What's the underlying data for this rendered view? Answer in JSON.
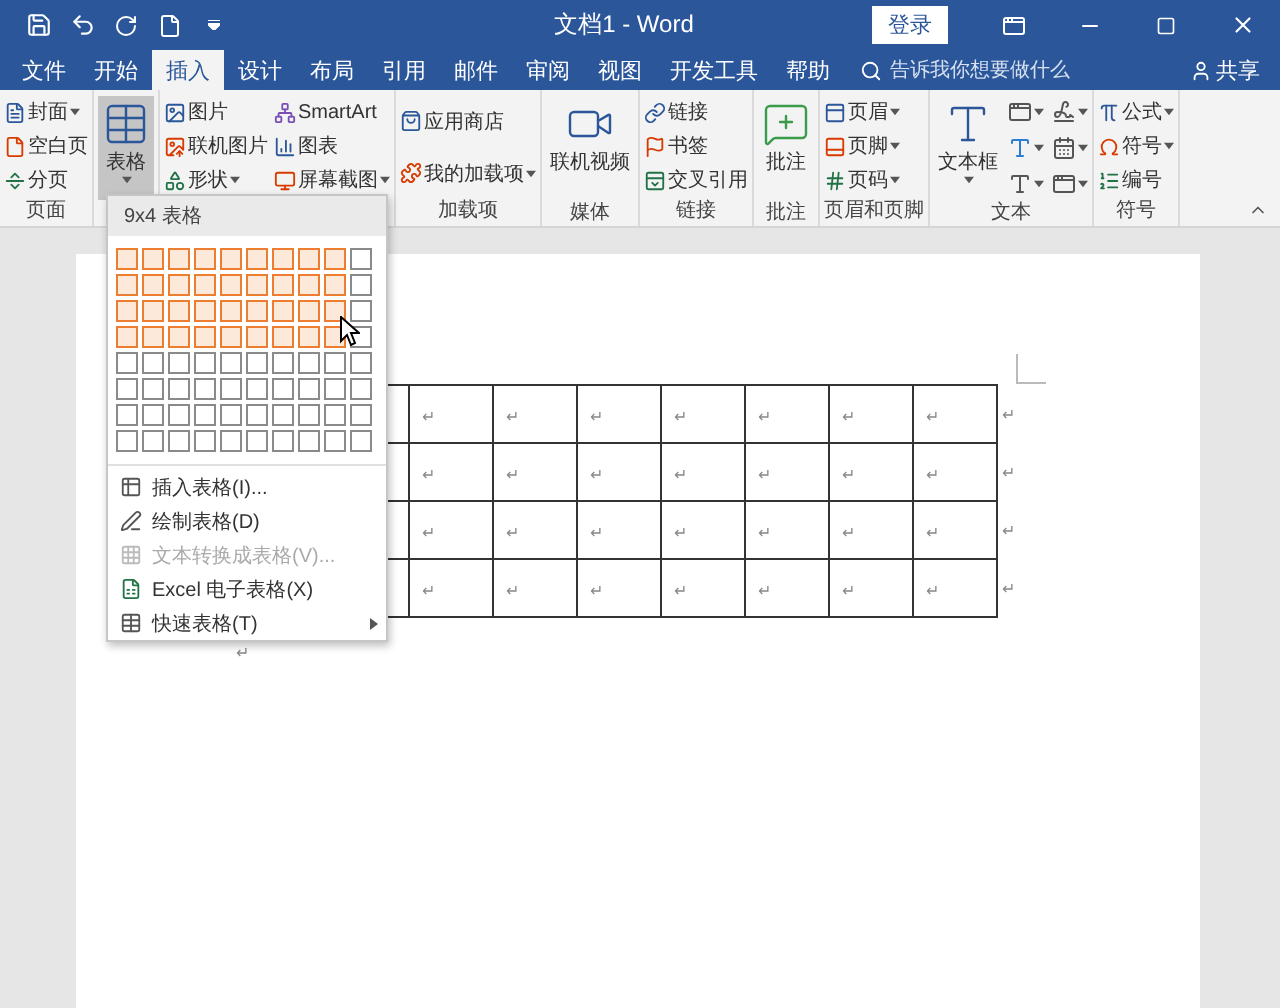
{
  "title_bar": {
    "title": "文档1 - Word",
    "sign_in": "登录"
  },
  "tabs": [
    {
      "label": "文件",
      "selected": false
    },
    {
      "label": "开始",
      "selected": false
    },
    {
      "label": "插入",
      "selected": true
    },
    {
      "label": "设计",
      "selected": false
    },
    {
      "label": "布局",
      "selected": false
    },
    {
      "label": "引用",
      "selected": false
    },
    {
      "label": "邮件",
      "selected": false
    },
    {
      "label": "审阅",
      "selected": false
    },
    {
      "label": "视图",
      "selected": false
    },
    {
      "label": "开发工具",
      "selected": false
    },
    {
      "label": "帮助",
      "selected": false
    }
  ],
  "search": {
    "placeholder": "告诉我你想要做什么"
  },
  "share": "共享",
  "ribbon": {
    "groups": [
      {
        "label": "页面",
        "items": [
          {
            "label": "封面",
            "kind": "small",
            "dropdown": true
          },
          {
            "label": "空白页",
            "kind": "small",
            "dropdown": false
          },
          {
            "label": "分页",
            "kind": "small",
            "dropdown": false
          }
        ]
      },
      {
        "items": [
          {
            "label": "表格",
            "kind": "large",
            "dropdown": true,
            "pressed": true
          }
        ]
      },
      {
        "items": [
          {
            "label": "图片",
            "kind": "small",
            "dropdown": false
          },
          {
            "label": "联机图片",
            "kind": "small",
            "dropdown": false
          },
          {
            "label": "形状",
            "kind": "small",
            "dropdown": true
          },
          {
            "label": "SmartArt",
            "kind": "small",
            "dropdown": false
          },
          {
            "label": "图表",
            "kind": "small",
            "dropdown": false
          },
          {
            "label": "屏幕截图",
            "kind": "small",
            "dropdown": true
          }
        ]
      },
      {
        "label": "加载项",
        "items": [
          {
            "label": "应用商店",
            "kind": "small",
            "dropdown": false
          },
          {
            "label": "我的加载项",
            "kind": "small",
            "dropdown": true
          }
        ]
      },
      {
        "label": "媒体",
        "items": [
          {
            "label": "联机视频",
            "kind": "large",
            "dropdown": false,
            "pressed": false
          }
        ]
      },
      {
        "label": "链接",
        "items": [
          {
            "label": "链接",
            "kind": "small",
            "dropdown": false
          },
          {
            "label": "书签",
            "kind": "small",
            "dropdown": false
          },
          {
            "label": "交叉引用",
            "kind": "small",
            "dropdown": false
          }
        ]
      },
      {
        "label": "批注",
        "items": [
          {
            "label": "批注",
            "kind": "large",
            "dropdown": false,
            "pressed": false
          }
        ]
      },
      {
        "label": "页眉和页脚",
        "items": [
          {
            "label": "页眉",
            "kind": "small",
            "dropdown": true
          },
          {
            "label": "页脚",
            "kind": "small",
            "dropdown": true
          },
          {
            "label": "页码",
            "kind": "small",
            "dropdown": true
          }
        ]
      },
      {
        "label": "文本",
        "items": [
          {
            "label": "文本框",
            "kind": "large",
            "dropdown": true,
            "pressed": false
          },
          {
            "kind": "icons"
          }
        ]
      },
      {
        "label": "符号",
        "items": [
          {
            "label": "公式",
            "kind": "small",
            "dropdown": true
          },
          {
            "label": "符号",
            "kind": "small",
            "dropdown": true
          },
          {
            "label": "编号",
            "kind": "small",
            "dropdown": false
          }
        ]
      }
    ]
  },
  "table_menu": {
    "header": "9x4 表格",
    "grid": [
      {
        "cells": [
          true,
          true,
          true,
          true,
          true,
          true,
          true,
          true,
          true,
          false
        ]
      },
      {
        "cells": [
          true,
          true,
          true,
          true,
          true,
          true,
          true,
          true,
          true,
          false
        ]
      },
      {
        "cells": [
          true,
          true,
          true,
          true,
          true,
          true,
          true,
          true,
          true,
          false
        ]
      },
      {
        "cells": [
          true,
          true,
          true,
          true,
          true,
          true,
          true,
          true,
          true,
          false
        ]
      },
      {
        "cells": [
          false,
          false,
          false,
          false,
          false,
          false,
          false,
          false,
          false,
          false
        ]
      },
      {
        "cells": [
          false,
          false,
          false,
          false,
          false,
          false,
          false,
          false,
          false,
          false
        ]
      },
      {
        "cells": [
          false,
          false,
          false,
          false,
          false,
          false,
          false,
          false,
          false,
          false
        ]
      },
      {
        "cells": [
          false,
          false,
          false,
          false,
          false,
          false,
          false,
          false,
          false,
          false
        ]
      }
    ],
    "items": [
      {
        "label": "插入表格(I)...",
        "disabled": false,
        "submenu": false
      },
      {
        "label": "绘制表格(D)",
        "disabled": false,
        "submenu": false
      },
      {
        "label": "文本转换成表格(V)...",
        "disabled": true,
        "submenu": false
      },
      {
        "label": "Excel 电子表格(X)",
        "disabled": false,
        "submenu": false
      },
      {
        "label": "快速表格(T)",
        "disabled": false,
        "submenu": true
      }
    ]
  },
  "document": {
    "table": {
      "rows": [
        {
          "cells": [
            "↵",
            "↵",
            "↵",
            "↵",
            "↵",
            "↵",
            "↵"
          ],
          "end_mark": "↵"
        },
        {
          "cells": [
            "↵",
            "↵",
            "↵",
            "↵",
            "↵",
            "↵",
            "↵"
          ],
          "end_mark": "↵"
        },
        {
          "cells": [
            "↵",
            "↵",
            "↵",
            "↵",
            "↵",
            "↵",
            "↵"
          ],
          "end_mark": "↵"
        },
        {
          "cells": [
            "↵",
            "↵",
            "↵",
            "↵",
            "↵",
            "↵",
            "↵"
          ],
          "end_mark": "↵"
        }
      ]
    },
    "paragraph_mark": "↵"
  }
}
